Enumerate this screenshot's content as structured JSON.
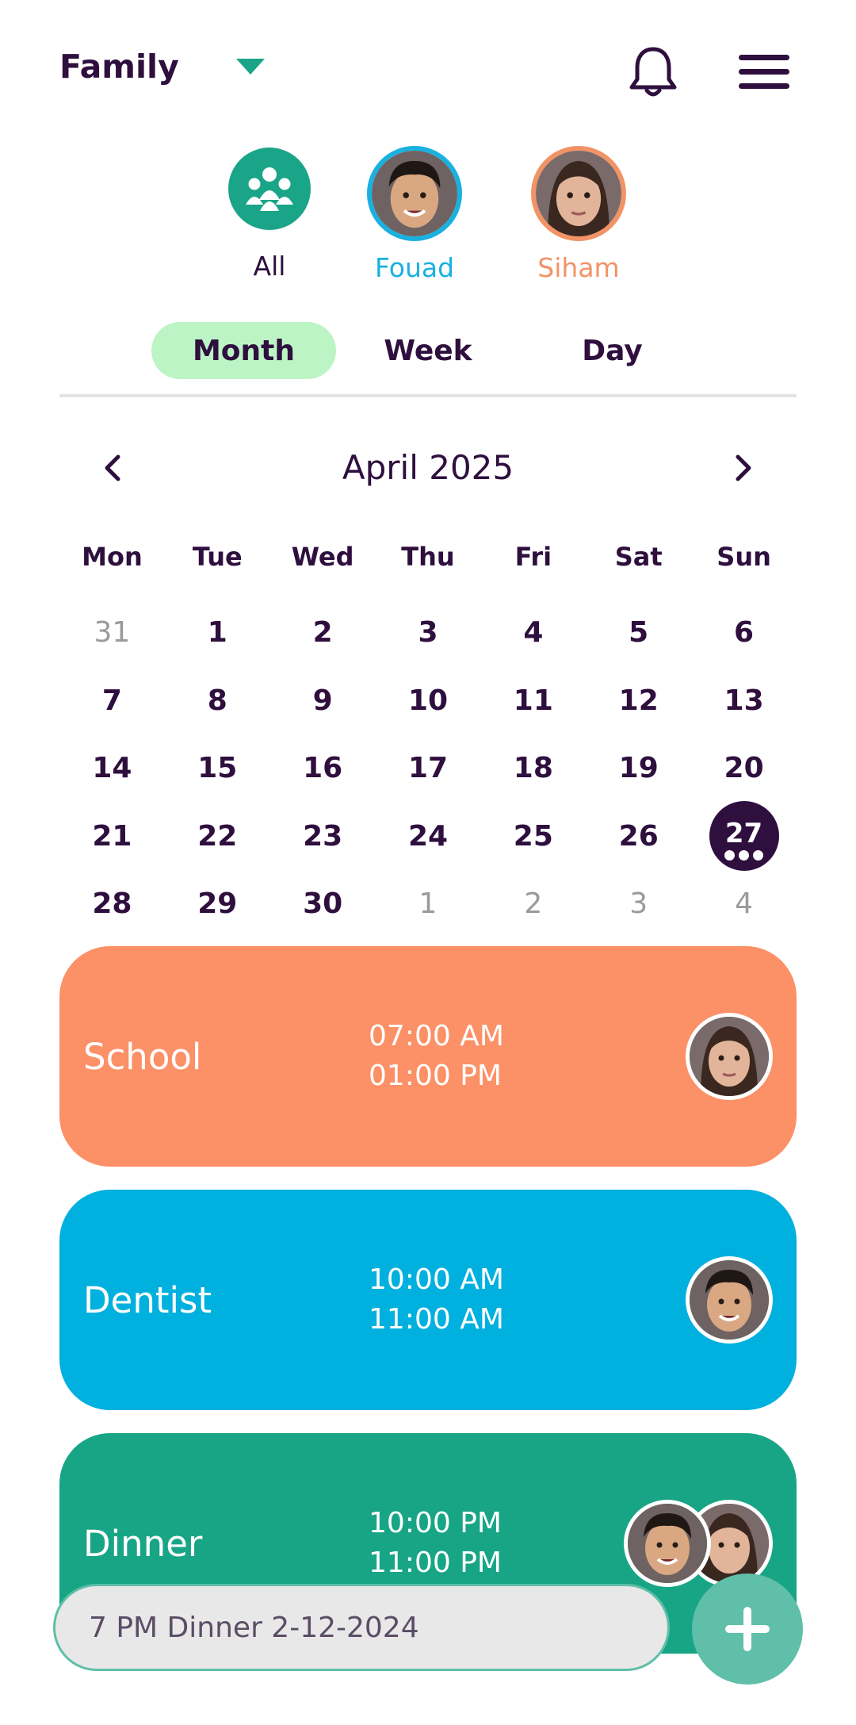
{
  "header": {
    "family_label": "Family",
    "icons": {
      "dropdown": "caret-down-icon",
      "bell": "bell-icon",
      "menu": "hamburger-menu-icon"
    }
  },
  "members": [
    {
      "name": "All",
      "color": "#1aa588",
      "icon": "group-icon"
    },
    {
      "name": "Fouad",
      "color": "#18b1e0"
    },
    {
      "name": "Siham",
      "color": "#f29366"
    }
  ],
  "tabs": [
    "Month",
    "Week",
    "Day"
  ],
  "active_tab": "Month",
  "calendar": {
    "month_title": "April 2025",
    "weekdays": [
      "Mon",
      "Tue",
      "Wed",
      "Thu",
      "Fri",
      "Sat",
      "Sun"
    ],
    "days": [
      "31",
      "1",
      "2",
      "3",
      "4",
      "5",
      "6",
      "7",
      "8",
      "9",
      "10",
      "11",
      "12",
      "13",
      "14",
      "15",
      "16",
      "17",
      "18",
      "19",
      "20",
      "21",
      "22",
      "23",
      "24",
      "25",
      "26",
      "27",
      "28",
      "29",
      "30",
      "1",
      "2",
      "3",
      "4"
    ],
    "today": "27"
  },
  "events": [
    {
      "title": "School",
      "start": "07:00 AM",
      "end": "01:00 PM",
      "color": "#fc9066"
    },
    {
      "title": "Dentist",
      "start": "10:00 AM",
      "end": "11:00 AM",
      "color": "#00b0de"
    },
    {
      "title": "Dinner",
      "start": "10:00 PM",
      "end": "11:00 PM",
      "color": "#18a585"
    }
  ],
  "quick_add": {
    "value": "7 PM Dinner 2-12-2024"
  },
  "colors": {
    "brand_dark": "#2e0f3e",
    "brand_green": "#1aa588",
    "tab_active": "#bdf4c5",
    "fab": "#5fbfa8"
  }
}
